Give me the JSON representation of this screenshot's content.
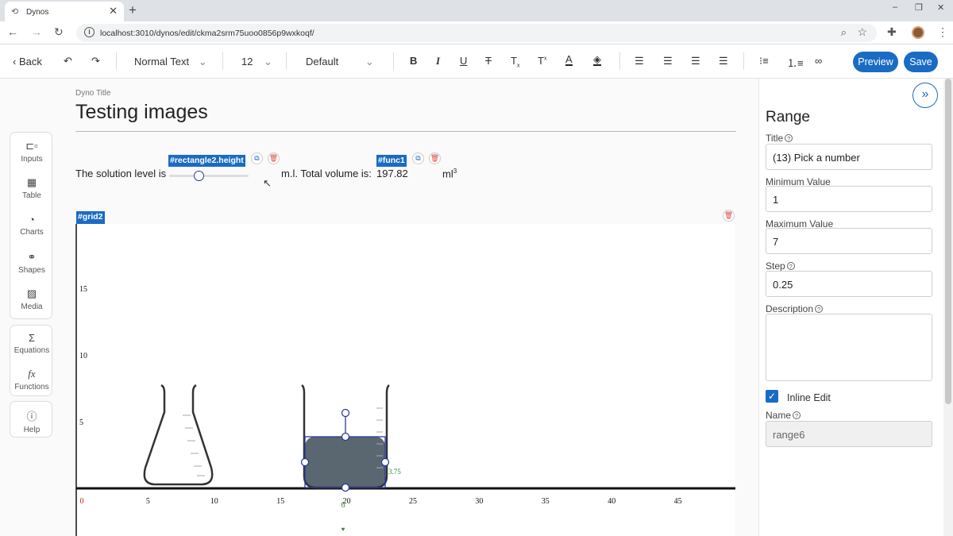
{
  "browser": {
    "tab_title": "Dynos",
    "new_tab": "+",
    "url": "localhost:3010/dynos/edit/ckma2srm75uoo0856p9wxkoqf/",
    "window_controls": [
      "–",
      "❐",
      "✕"
    ]
  },
  "toolbar": {
    "back_label": "Back",
    "text_style": "Normal Text",
    "font_size": "12",
    "font_family": "Default",
    "preview_label": "Preview",
    "save_label": "Save",
    "format_icons": [
      "B",
      "I",
      "U",
      "T",
      "T",
      "T",
      "A",
      "fill",
      "align-left",
      "align-center",
      "align-right",
      "justify",
      "bullets",
      "numbering",
      "link"
    ]
  },
  "palette": {
    "group1": [
      {
        "label": "Inputs",
        "icon": "input-icon"
      },
      {
        "label": "Table",
        "icon": "table-icon"
      },
      {
        "label": "Charts",
        "icon": "chart-icon"
      },
      {
        "label": "Shapes",
        "icon": "shapes-icon"
      },
      {
        "label": "Media",
        "icon": "image-icon"
      }
    ],
    "group2": [
      {
        "label": "Equations",
        "icon": "sigma-icon"
      },
      {
        "label": "Functions",
        "icon": "fx-icon"
      }
    ],
    "group3": [
      {
        "label": "Help",
        "icon": "help-icon"
      }
    ]
  },
  "document": {
    "title_label": "Dyno Title",
    "title": "Testing images",
    "sentence_start": "The solution level is",
    "slider_tag": "#rectangle2.height",
    "slider_value": 0.375,
    "sentence_mid": "m.l. Total volume is:",
    "func_tag": "#func1",
    "volume": "197.82",
    "unit": "ml",
    "unit_sup": "3",
    "grid_tag": "#grid2"
  },
  "grid": {
    "y_ticks": [
      "15",
      "10",
      "5"
    ],
    "x_ticks": [
      "0",
      "5",
      "10",
      "15",
      "20",
      "25",
      "30",
      "35",
      "40",
      "45"
    ],
    "handle_label_x": "6",
    "handle_label_y": "3.75",
    "bottom_glyph": "♥",
    "colors": {
      "liquid": "#5b6770",
      "handles": "#2a3a9a",
      "axis": "#111111",
      "origin_label": "#cc2200",
      "handle_label": "#2e8b2e"
    }
  },
  "panel": {
    "heading": "Range",
    "title_label": "Title",
    "title_value": "(13) Pick a number",
    "min_label": "Minimum Value",
    "min_value": "1",
    "max_label": "Maximum Value",
    "max_value": "7",
    "step_label": "Step",
    "step_value": "0.25",
    "description_label": "Description",
    "description_value": "",
    "inline_edit_label": "Inline Edit",
    "inline_edit_checked": true,
    "name_label": "Name",
    "name_value": "range6"
  },
  "colors": {
    "accent": "#1a6bc4",
    "delete": "#e04848"
  }
}
